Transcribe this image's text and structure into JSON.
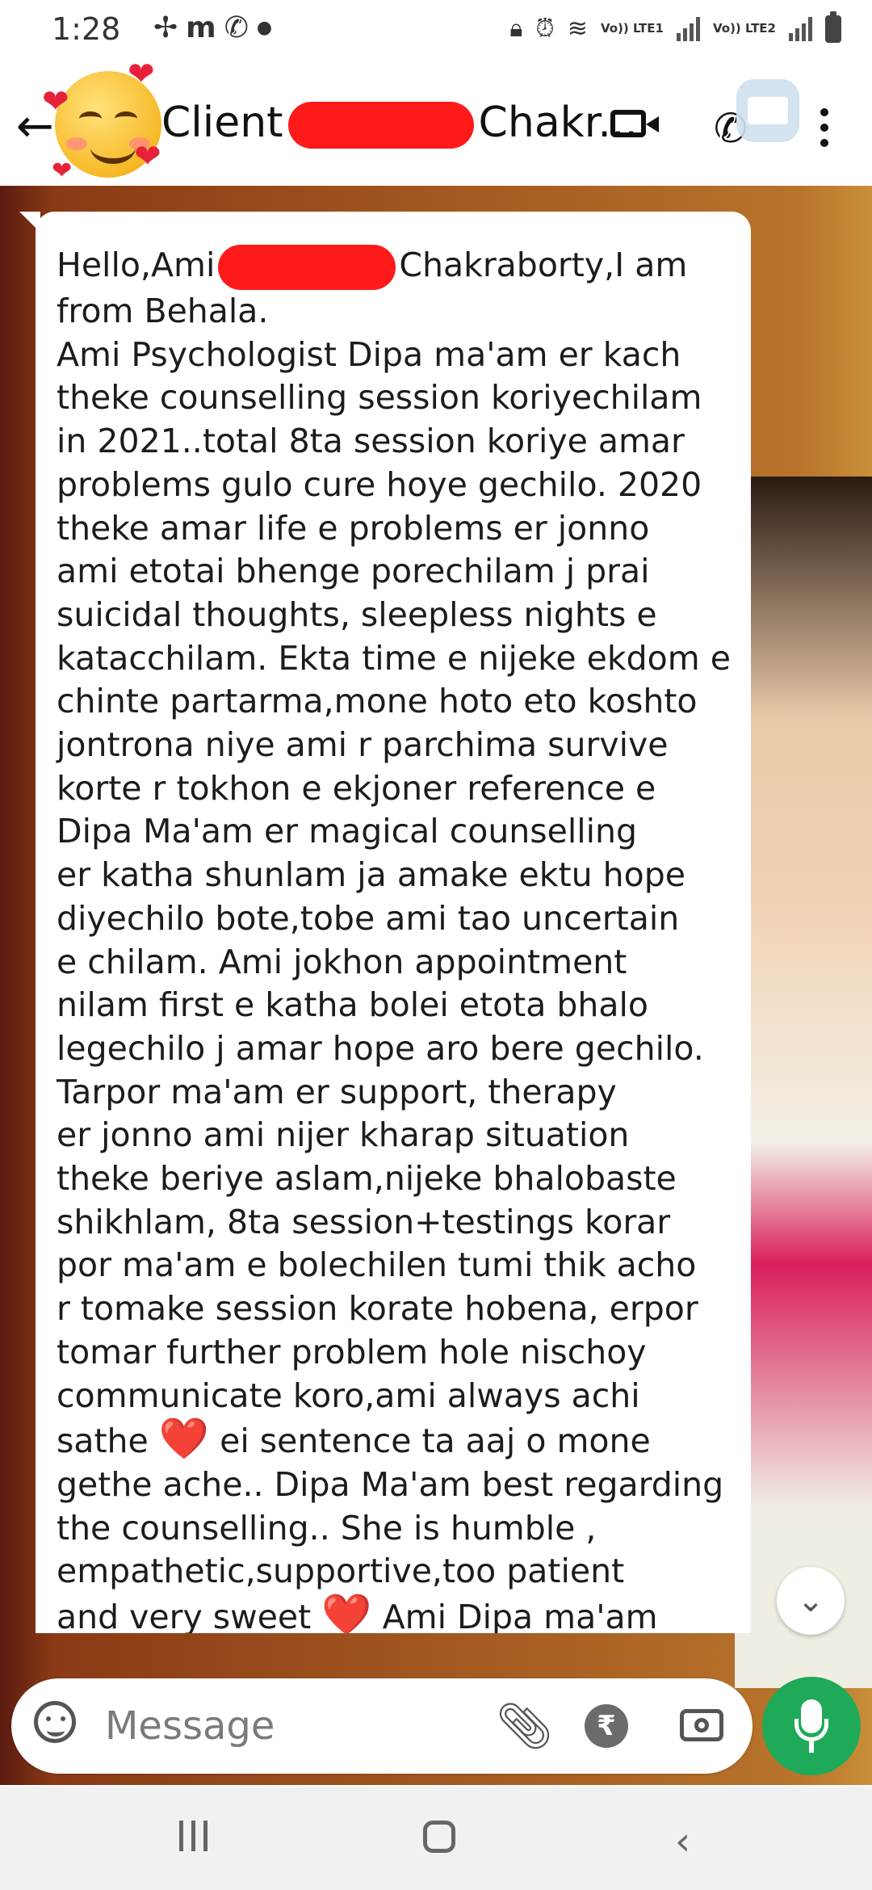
{
  "status_bar": {
    "time": "1:28",
    "left_icons": [
      "pinwheel-icon",
      "m-icon",
      "whatsapp-icon",
      "dot-icon"
    ],
    "sim1_label": "Vo)) LTE1",
    "sim2_label": "Vo)) LTE2",
    "right_icons": [
      "lock-icon",
      "alarm-icon",
      "wifi-icon",
      "signal-icon",
      "battery-icon"
    ]
  },
  "header": {
    "contact_name_prefix": "Client",
    "contact_name_suffix": "Chakr...",
    "actions": [
      "video-call",
      "voice-call",
      "more-options"
    ]
  },
  "message": {
    "greeting_prefix": "Hello,Ami",
    "greeting_suffix": "Chakraborty,I am\nfrom Behala.",
    "body_1": "Ami Psychologist Dipa ma'am er kach\ntheke counselling session koriyechilam\nin 2021..total 8ta session koriye amar\nproblems gulo cure hoye gechilo. 2020\ntheke amar life e problems er jonno\nami etotai bhenge porechilam j prai\nsuicidal thoughts, sleepless nights e\nkatacchilam. Ekta time e nijeke ekdom e\nchinte partarma,mone hoto eto koshto\njontrona niye ami r parchima survive\nkorte r tokhon e ekjoner reference e\nDipa Ma'am er magical counselling\ner katha shunlam ja amake ektu hope\ndiyechilo bote,tobe ami tao uncertain\ne chilam. Ami jokhon appointment\nnilam first e katha bolei etota bhalo\nlegechilo j amar hope aro bere gechilo.\nTarpor ma'am er support, therapy\ner jonno ami nijer kharap situation\ntheke beriye aslam,nijeke bhalobaste\nshikhlam, 8ta session+testings korar\npor ma'am e bolechilen tumi thik acho\nr tomake session korate hobena, erpor\ntomar further problem hole nischoy\ncommunicate koro,ami always achi\nsathe",
    "heart_1": "❤️",
    "body_2": "ei sentence ta aaj o mone\ngethe ache.. Dipa Ma'am best regarding\nthe counselling.. She is humble ,\nempathetic,supportive,too patient\nand very sweet",
    "heart_2": "❤️",
    "body_3": "Ami Dipa ma'am"
  },
  "composer": {
    "placeholder": "Message",
    "rupee_symbol": "₹"
  },
  "scroll_button_glyph": "⌄",
  "colors": {
    "accent_green": "#1faa59",
    "redaction_red": "#ff1a1a",
    "heart_red": "#e8213a"
  }
}
